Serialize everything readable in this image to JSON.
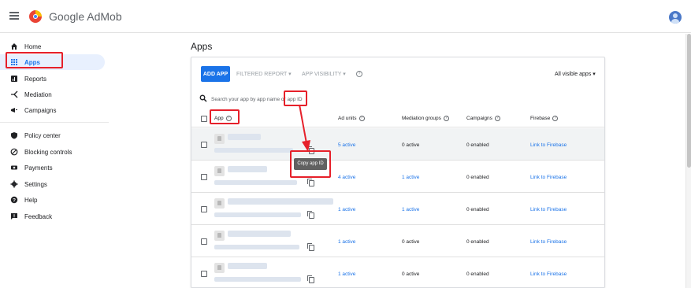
{
  "app": {
    "brand": "Google AdMob"
  },
  "sidebar": {
    "items": [
      {
        "label": "Home",
        "icon": "home-icon"
      },
      {
        "label": "Apps",
        "icon": "apps-grid-icon",
        "active": true
      },
      {
        "label": "Reports",
        "icon": "reports-icon"
      },
      {
        "label": "Mediation",
        "icon": "mediation-icon"
      },
      {
        "label": "Campaigns",
        "icon": "campaigns-icon"
      },
      {
        "label": "Policy center",
        "icon": "shield-icon"
      },
      {
        "label": "Blocking controls",
        "icon": "block-icon"
      },
      {
        "label": "Payments",
        "icon": "payments-icon"
      },
      {
        "label": "Settings",
        "icon": "gear-icon"
      },
      {
        "label": "Help",
        "icon": "help-icon"
      },
      {
        "label": "Feedback",
        "icon": "feedback-icon"
      }
    ]
  },
  "main": {
    "title": "Apps",
    "toolbar": {
      "add_app": "ADD APP",
      "filtered_report": "FILTERED REPORT ▾",
      "app_visibility": "APP VISIBILITY ▾",
      "help": "?",
      "visible_select": "All visible apps ▾"
    },
    "search": {
      "placeholder": "Search your app by app name or app ID"
    },
    "columns": [
      "App",
      "Ad units",
      "Mediation groups",
      "Campaigns",
      "Firebase"
    ],
    "rows": [
      {
        "ad_units": "5 active",
        "mediation": "0 active",
        "campaigns": "0 enabled",
        "firebase": "Link to Firebase"
      },
      {
        "ad_units": "4 active",
        "mediation": "1 active",
        "campaigns": "0 enabled",
        "firebase": "Link to Firebase"
      },
      {
        "ad_units": "1 active",
        "mediation": "1 active",
        "campaigns": "0 enabled",
        "firebase": "Link to Firebase"
      },
      {
        "ad_units": "1 active",
        "mediation": "0 active",
        "campaigns": "0 enabled",
        "firebase": "Link to Firebase"
      },
      {
        "ad_units": "1 active",
        "mediation": "0 active",
        "campaigns": "0 enabled",
        "firebase": "Link to Firebase"
      }
    ],
    "tooltip": "Copy app ID"
  },
  "colors": {
    "accent": "#1a73e8",
    "annotation": "#e6202a",
    "active_bg": "#e8f0fe"
  }
}
